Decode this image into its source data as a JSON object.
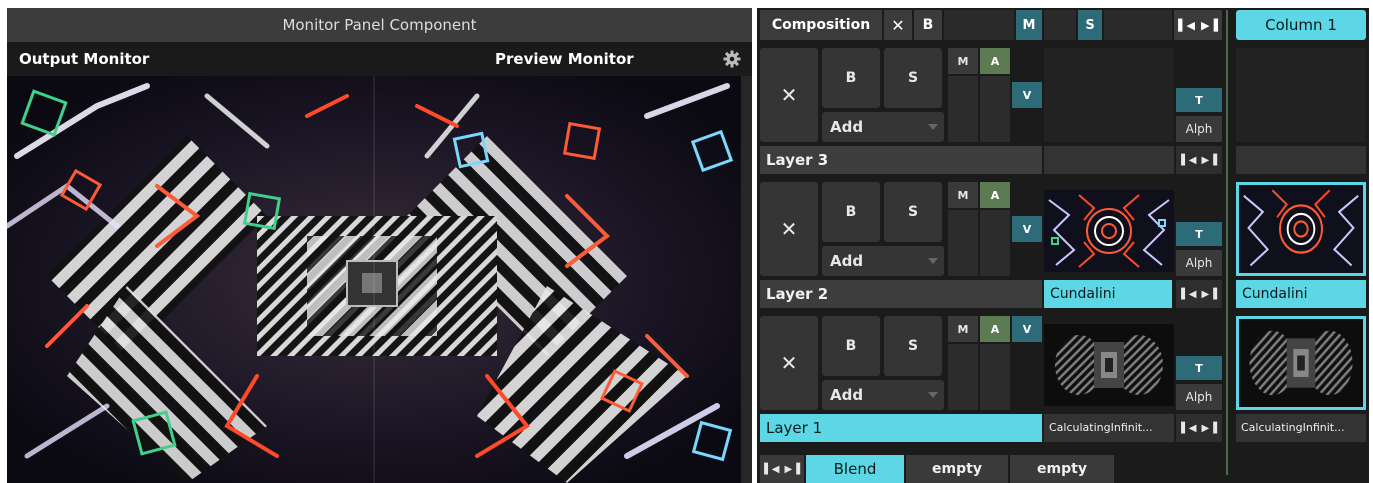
{
  "monitor_panel": {
    "title": "Monitor Panel Component",
    "output_label": "Output Monitor",
    "preview_label": "Preview Monitor"
  },
  "composition_bar": {
    "label": "Composition",
    "x_label": "✕",
    "b_label": "B",
    "m_label": "M",
    "s_label": "S",
    "column_label": "Column 1"
  },
  "layers": [
    {
      "name": "Layer 3",
      "x": "✕",
      "b": "B",
      "s": "S",
      "blend": "Add",
      "m": "M",
      "a": "A",
      "v": "V",
      "t": "T",
      "alph": "Alph",
      "clip": "",
      "column_clip": ""
    },
    {
      "name": "Layer 2",
      "x": "✕",
      "b": "B",
      "s": "S",
      "blend": "Add",
      "m": "M",
      "a": "A",
      "v": "V",
      "t": "T",
      "alph": "Alph",
      "clip": "Cundalini",
      "column_clip": "Cundalini"
    },
    {
      "name": "Layer 1",
      "x": "✕",
      "b": "B",
      "s": "S",
      "blend": "Add",
      "m": "M",
      "a": "A",
      "v": "V",
      "t": "T",
      "alph": "Alph",
      "clip": "CalculatingInfinit...",
      "column_clip": "CalculatingInfinit..."
    }
  ],
  "bottom_bar": {
    "blend": "Blend",
    "slot1": "empty",
    "slot2": "empty"
  },
  "colors": {
    "accent": "#5dd6e6",
    "teal": "#2e6b78",
    "green": "#5d7b52",
    "panel": "#2a2a2a"
  }
}
